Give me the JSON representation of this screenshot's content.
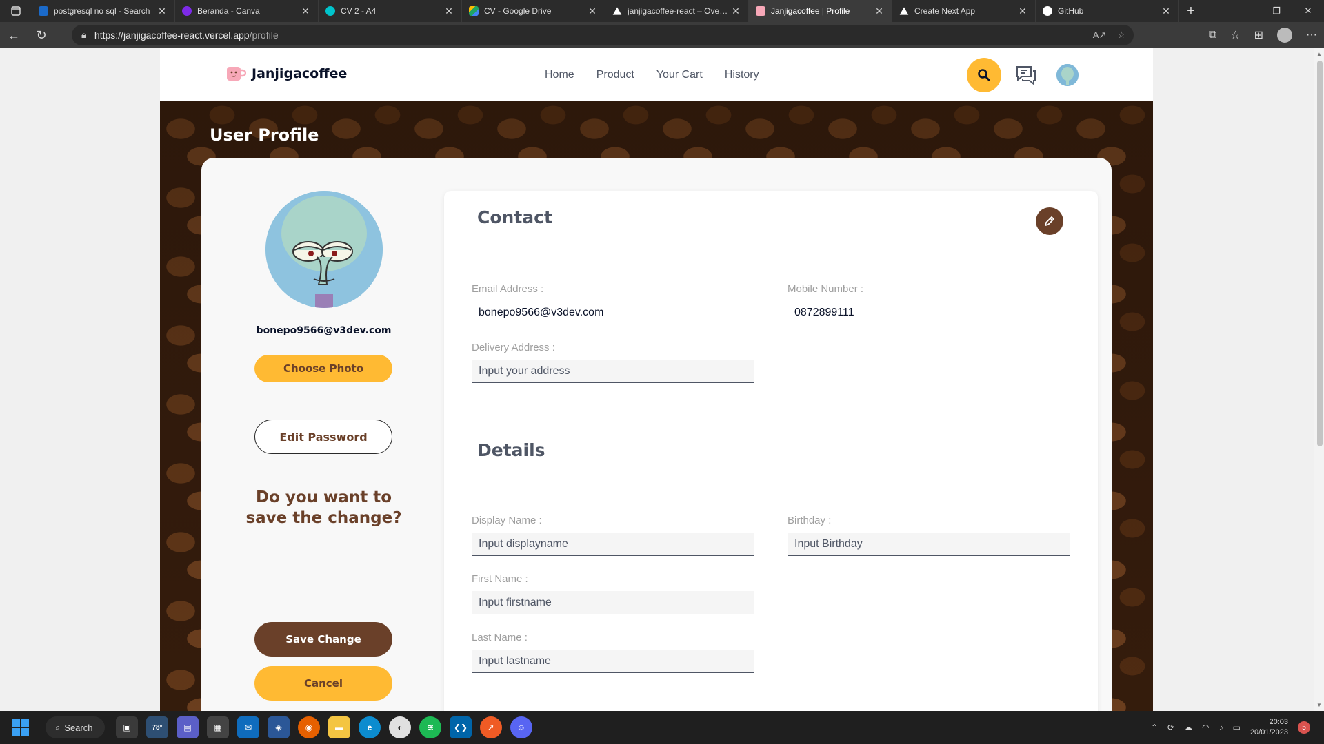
{
  "browser": {
    "tabs": [
      {
        "title": "postgresql no sql - Search",
        "color": "#1b6ac9"
      },
      {
        "title": "Beranda - Canva",
        "color": "#7d2ae8"
      },
      {
        "title": "CV 2 - A4",
        "color": "#00c4cc"
      },
      {
        "title": "CV - Google Drive",
        "color": "#1fa463"
      },
      {
        "title": "janjigacoffee-react – Overview",
        "color": "#000000"
      },
      {
        "title": "Janjigacoffee | Profile",
        "color": "#f7a8b8",
        "active": true
      },
      {
        "title": "Create Next App",
        "color": "#000000"
      },
      {
        "title": "GitHub",
        "color": "#ffffff"
      }
    ],
    "url_host": "https://janjigacoffee-react.vercel.app",
    "url_path": "/profile"
  },
  "site": {
    "brand": "Janjigacoffee",
    "nav": [
      "Home",
      "Product",
      "Your Cart",
      "History"
    ]
  },
  "profile": {
    "page_title": "User Profile",
    "email": "bonepo9566@v3dev.com",
    "choose_photo": "Choose Photo",
    "edit_password": "Edit Password",
    "save_question": "Do you want to save the change?",
    "save_change": "Save Change",
    "cancel": "Cancel"
  },
  "contact": {
    "title": "Contact",
    "email_label": "Email Address :",
    "email_value": "bonepo9566@v3dev.com",
    "mobile_label": "Mobile Number :",
    "mobile_value": "0872899111",
    "address_label": "Delivery Address :",
    "address_placeholder": "Input your address"
  },
  "details": {
    "title": "Details",
    "display_label": "Display Name :",
    "display_placeholder": "Input displayname",
    "birthday_label": "Birthday :",
    "birthday_placeholder": "Input Birthday",
    "first_label": "First Name :",
    "first_placeholder": "Input firstname",
    "last_label": "Last Name :",
    "last_placeholder": "Input lastname"
  },
  "taskbar": {
    "search": "Search",
    "weather": "78°",
    "time": "20:03",
    "date": "20/01/2023",
    "notifications": "5"
  },
  "colors": {
    "accent_yellow": "#ffba33",
    "brown": "#6a4029"
  }
}
